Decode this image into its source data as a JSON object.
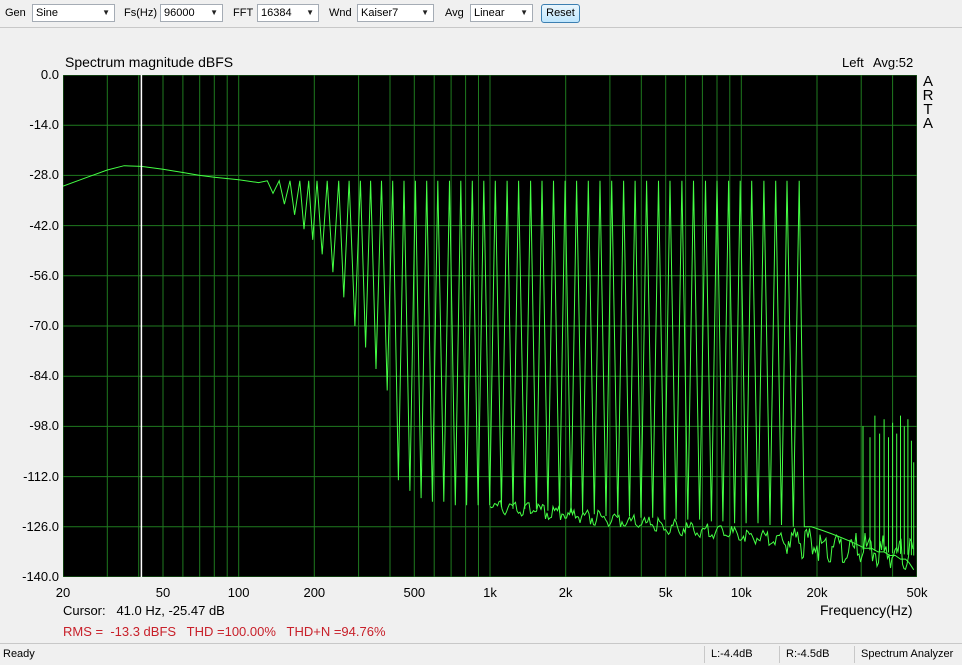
{
  "toolbar": {
    "gen_label": "Gen",
    "gen_value": "Sine",
    "fs_label": "Fs(Hz)",
    "fs_value": "96000",
    "fft_label": "FFT",
    "fft_value": "16384",
    "wnd_label": "Wnd",
    "wnd_value": "Kaiser7",
    "avg_label": "Avg",
    "avg_value": "Linear",
    "reset_label": "Reset"
  },
  "plot": {
    "title": "Spectrum magnitude dBFS",
    "channel": "Left",
    "avg": "Avg:52",
    "watermark": [
      "A",
      "R",
      "T",
      "A"
    ],
    "xlabel": "Frequency(Hz)",
    "cursor": "Cursor:   41.0 Hz, -25.47 dB",
    "stats": "RMS =  -13.3 dBFS   THD =100.00%   THD+N =94.76%"
  },
  "status": {
    "ready": "Ready",
    "left_level": "L:-4.4dB",
    "right_level": "R:-4.5dB",
    "mode": "Spectrum Analyzer"
  },
  "chart_data": {
    "type": "line",
    "title": "Spectrum magnitude dBFS",
    "xlabel": "Frequency(Hz)",
    "ylabel": "",
    "x_scale": "log",
    "xlim": [
      20,
      50000
    ],
    "ylim": [
      -140,
      0
    ],
    "grid": true,
    "background": "#000000",
    "line_color": "#44ff44",
    "grid_color": "#1f7a1f",
    "cursor_x": 41.0,
    "y_ticks": [
      "0.0",
      "-14.0",
      "-28.0",
      "-42.0",
      "-56.0",
      "-70.0",
      "-84.0",
      "-98.0",
      "-112.0",
      "-126.0",
      "-140.0"
    ],
    "x_ticks": [
      {
        "v": 20,
        "label": "20"
      },
      {
        "v": 50,
        "label": "50"
      },
      {
        "v": 100,
        "label": "100"
      },
      {
        "v": 200,
        "label": "200"
      },
      {
        "v": 500,
        "label": "500"
      },
      {
        "v": 1000,
        "label": "1k"
      },
      {
        "v": 2000,
        "label": "2k"
      },
      {
        "v": 5000,
        "label": "5k"
      },
      {
        "v": 10000,
        "label": "10k"
      },
      {
        "v": 20000,
        "label": "20k"
      },
      {
        "v": 50000,
        "label": "50k"
      }
    ],
    "envelope": [
      [
        20,
        -31
      ],
      [
        25,
        -28.5
      ],
      [
        30,
        -26.5
      ],
      [
        35,
        -25.3
      ],
      [
        41,
        -25.5
      ],
      [
        50,
        -26.3
      ],
      [
        60,
        -27.2
      ],
      [
        70,
        -28
      ],
      [
        80,
        -28.5
      ],
      [
        100,
        -29.2
      ],
      [
        120,
        -30
      ]
    ],
    "peaks": [
      [
        130,
        -29.5
      ],
      [
        145,
        -29.5
      ],
      [
        160,
        -29.5
      ],
      [
        175,
        -29.5
      ],
      [
        190,
        -29.5
      ],
      [
        205,
        -29.5
      ],
      [
        225,
        -29.5
      ],
      [
        250,
        -29.5
      ],
      [
        275,
        -29.5
      ],
      [
        305,
        -29.5
      ],
      [
        335,
        -29.5
      ],
      [
        370,
        -29.5
      ],
      [
        410,
        -29.5
      ],
      [
        455,
        -29.5
      ],
      [
        505,
        -29.5
      ],
      [
        560,
        -29.5
      ],
      [
        620,
        -29.5
      ],
      [
        690,
        -29.5
      ],
      [
        765,
        -29.5
      ],
      [
        850,
        -29.5
      ],
      [
        945,
        -29.5
      ],
      [
        1050,
        -29.5
      ],
      [
        1170,
        -29.5
      ],
      [
        1300,
        -29.5
      ],
      [
        1450,
        -29.5
      ],
      [
        1610,
        -29.5
      ],
      [
        1790,
        -29.5
      ],
      [
        1990,
        -29.5
      ],
      [
        2210,
        -29.5
      ],
      [
        2460,
        -29.5
      ],
      [
        2740,
        -29.5
      ],
      [
        3050,
        -29.5
      ],
      [
        3400,
        -29.5
      ],
      [
        3780,
        -29.5
      ],
      [
        4200,
        -29.5
      ],
      [
        4680,
        -29.5
      ],
      [
        5200,
        -29.5
      ],
      [
        5800,
        -29.5
      ],
      [
        6450,
        -29.5
      ],
      [
        7200,
        -29.5
      ],
      [
        8000,
        -29.5
      ],
      [
        8900,
        -29.5
      ],
      [
        9900,
        -29.5
      ],
      [
        11000,
        -29.5
      ],
      [
        12300,
        -29.5
      ],
      [
        13700,
        -29.5
      ],
      [
        15200,
        -29.5
      ],
      [
        17000,
        -29.5
      ]
    ],
    "valleys": [
      [
        137,
        -33
      ],
      [
        152,
        -36
      ],
      [
        167,
        -39
      ],
      [
        182,
        -43
      ],
      [
        197,
        -46
      ],
      [
        215,
        -50
      ],
      [
        237,
        -55
      ],
      [
        262,
        -62
      ],
      [
        290,
        -70
      ],
      [
        320,
        -76
      ],
      [
        352,
        -82
      ],
      [
        390,
        -88
      ],
      [
        432,
        -113
      ],
      [
        480,
        -116
      ],
      [
        532,
        -118
      ],
      [
        590,
        -119
      ],
      [
        655,
        -119
      ],
      [
        728,
        -120
      ],
      [
        807,
        -120
      ],
      [
        897,
        -120
      ],
      [
        997,
        -120
      ],
      [
        1110,
        -120.5
      ],
      [
        1235,
        -121
      ],
      [
        1375,
        -121
      ],
      [
        1530,
        -121
      ],
      [
        1700,
        -121.5
      ],
      [
        1890,
        -122
      ],
      [
        2100,
        -122
      ],
      [
        2335,
        -122
      ],
      [
        2600,
        -122.5
      ],
      [
        2895,
        -123
      ],
      [
        3225,
        -123
      ],
      [
        3590,
        -123
      ],
      [
        3990,
        -123.5
      ],
      [
        4440,
        -123.5
      ],
      [
        4940,
        -124
      ],
      [
        5500,
        -124
      ],
      [
        6125,
        -124
      ],
      [
        6825,
        -124
      ],
      [
        7600,
        -124.5
      ],
      [
        8450,
        -124.5
      ],
      [
        9400,
        -125
      ],
      [
        10450,
        -125
      ],
      [
        11650,
        -125
      ],
      [
        13000,
        -125.5
      ],
      [
        14450,
        -125.5
      ],
      [
        16100,
        -126
      ],
      [
        17800,
        -126
      ]
    ],
    "tail": [
      [
        19000,
        -126
      ],
      [
        21000,
        -127
      ],
      [
        23000,
        -128
      ],
      [
        25000,
        -129
      ],
      [
        27000,
        -130
      ],
      [
        29000,
        -131
      ],
      [
        31000,
        -132
      ],
      [
        33000,
        -132
      ],
      [
        35000,
        -133
      ],
      [
        37000,
        -133
      ],
      [
        39000,
        -134
      ],
      [
        41000,
        -134
      ],
      [
        43000,
        -135
      ],
      [
        45000,
        -135
      ],
      [
        46500,
        -136
      ],
      [
        47500,
        -137
      ],
      [
        48500,
        -138
      ]
    ],
    "hf_spurs": [
      [
        30500,
        -98
      ],
      [
        32500,
        -101
      ],
      [
        34000,
        -95
      ],
      [
        35500,
        -100
      ],
      [
        37000,
        -96
      ],
      [
        38500,
        -101
      ],
      [
        40000,
        -97
      ],
      [
        41500,
        -100
      ],
      [
        43000,
        -95
      ],
      [
        44500,
        -98
      ],
      [
        46000,
        -96
      ],
      [
        47500,
        -102
      ],
      [
        48500,
        -108
      ]
    ]
  }
}
